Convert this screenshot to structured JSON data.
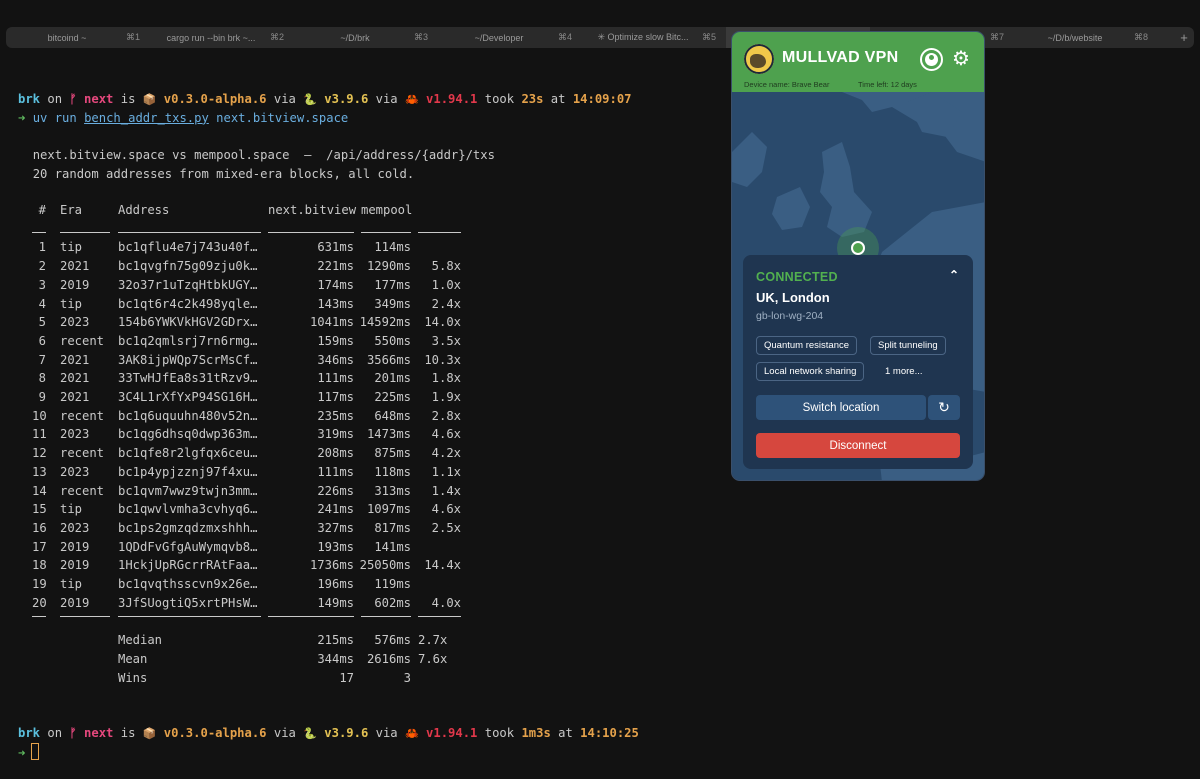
{
  "tabs": [
    {
      "name": "bitcoind ~",
      "key": "⌘1"
    },
    {
      "name": "cargo run --bin brk ~...",
      "key": "⌘2"
    },
    {
      "name": "~/D/brk",
      "key": "⌘3"
    },
    {
      "name": "~/Developer",
      "key": "⌘4"
    },
    {
      "name": "✳ Optimize slow Bitc...",
      "key": "⌘5"
    },
    {
      "name": "",
      "key": ""
    },
    {
      "name": "",
      "key": "⌘7"
    },
    {
      "name": "~/D/b/website",
      "key": "⌘8"
    }
  ],
  "tab_plus": "+",
  "prompt1": {
    "user": "brk",
    "on": " on ",
    "branch_icon": "ᚠ",
    "branch": "next",
    "is": " is ",
    "pkg_icon": "📦",
    "version": "v0.3.0-alpha.6",
    "via1": " via ",
    "py_icon": "🐍",
    "py": "v3.9.6",
    "via2": " via ",
    "rust_icon": "🦀",
    "rust": "v1.94.1",
    "took": " took ",
    "duration": "23s",
    "at": " at ",
    "time": "14:09:07"
  },
  "command": {
    "arrow": "➜",
    "uv": "uv",
    "run": "run",
    "script": "bench_addr_txs.py",
    "arg": "next.bitview.space"
  },
  "desc1": "next.bitview.space vs mempool.space  —  /api/address/{addr}/txs",
  "desc2": "20 random addresses from mixed-era blocks, all cold.",
  "table": {
    "headers": {
      "num": "#",
      "era": "Era",
      "address": "Address",
      "next": "next.bitview",
      "mempool": "mempool"
    },
    "rows": [
      {
        "n": "1",
        "era": "tip",
        "addr": "bc1qflu4e7j743u40f…",
        "next": "631ms",
        "mem": "114ms",
        "ratio": ""
      },
      {
        "n": "2",
        "era": "2021",
        "addr": "bc1qvgfn75g09zju0k…",
        "next": "221ms",
        "mem": "1290ms",
        "ratio": "5.8x"
      },
      {
        "n": "3",
        "era": "2019",
        "addr": "32o37r1uTzqHtbkUGY…",
        "next": "174ms",
        "mem": "177ms",
        "ratio": "1.0x"
      },
      {
        "n": "4",
        "era": "tip",
        "addr": "bc1qt6r4c2k498yqle…",
        "next": "143ms",
        "mem": "349ms",
        "ratio": "2.4x"
      },
      {
        "n": "5",
        "era": "2023",
        "addr": "154b6YWKVkHGV2GDrx…",
        "next": "1041ms",
        "mem": "14592ms",
        "ratio": "14.0x"
      },
      {
        "n": "6",
        "era": "recent",
        "addr": "bc1q2qmlsrj7rn6rmg…",
        "next": "159ms",
        "mem": "550ms",
        "ratio": "3.5x"
      },
      {
        "n": "7",
        "era": "2021",
        "addr": "3AK8ijpWQp7ScrMsCf…",
        "next": "346ms",
        "mem": "3566ms",
        "ratio": "10.3x"
      },
      {
        "n": "8",
        "era": "2021",
        "addr": "33TwHJfEa8s31tRzv9…",
        "next": "111ms",
        "mem": "201ms",
        "ratio": "1.8x"
      },
      {
        "n": "9",
        "era": "2021",
        "addr": "3C4L1rXfYxP94SG16H…",
        "next": "117ms",
        "mem": "225ms",
        "ratio": "1.9x"
      },
      {
        "n": "10",
        "era": "recent",
        "addr": "bc1q6uquuhn480v52n…",
        "next": "235ms",
        "mem": "648ms",
        "ratio": "2.8x"
      },
      {
        "n": "11",
        "era": "2023",
        "addr": "bc1qg6dhsq0dwp363m…",
        "next": "319ms",
        "mem": "1473ms",
        "ratio": "4.6x"
      },
      {
        "n": "12",
        "era": "recent",
        "addr": "bc1qfe8r2lgfqx6ceu…",
        "next": "208ms",
        "mem": "875ms",
        "ratio": "4.2x"
      },
      {
        "n": "13",
        "era": "2023",
        "addr": "bc1p4ypjzznj97f4xu…",
        "next": "111ms",
        "mem": "118ms",
        "ratio": "1.1x"
      },
      {
        "n": "14",
        "era": "recent",
        "addr": "bc1qvm7wwz9twjn3mm…",
        "next": "226ms",
        "mem": "313ms",
        "ratio": "1.4x"
      },
      {
        "n": "15",
        "era": "tip",
        "addr": "bc1qwvlvmha3cvhyq6…",
        "next": "241ms",
        "mem": "1097ms",
        "ratio": "4.6x"
      },
      {
        "n": "16",
        "era": "2023",
        "addr": "bc1ps2gmzqdzmxshhh…",
        "next": "327ms",
        "mem": "817ms",
        "ratio": "2.5x"
      },
      {
        "n": "17",
        "era": "2019",
        "addr": "1QDdFvGfgAuWymqvb8…",
        "next": "193ms",
        "mem": "141ms",
        "ratio": ""
      },
      {
        "n": "18",
        "era": "2019",
        "addr": "1HckjUpRGcrrRAtFaa…",
        "next": "1736ms",
        "mem": "25050ms",
        "ratio": "14.4x"
      },
      {
        "n": "19",
        "era": "tip",
        "addr": "bc1qvqthsscvn9x26e…",
        "next": "196ms",
        "mem": "119ms",
        "ratio": ""
      },
      {
        "n": "20",
        "era": "2019",
        "addr": "3JfSUogtiQ5xrtPHsW…",
        "next": "149ms",
        "mem": "602ms",
        "ratio": "4.0x"
      }
    ],
    "summary": [
      {
        "label": "Median",
        "next": "215ms",
        "mem": "576ms",
        "ratio": "2.7x"
      },
      {
        "label": "Mean",
        "next": "344ms",
        "mem": "2616ms",
        "ratio": "7.6x"
      },
      {
        "label": "Wins",
        "next": "17",
        "mem": "3",
        "ratio": ""
      }
    ]
  },
  "prompt2": {
    "user": "brk",
    "on": " on ",
    "branch_icon": "ᚠ",
    "branch": "next",
    "is": " is ",
    "pkg_icon": "📦",
    "version": "v0.3.0-alpha.6",
    "via1": " via ",
    "py_icon": "🐍",
    "py": "v3.9.6",
    "via2": " via ",
    "rust_icon": "🦀",
    "rust": "v1.94.1",
    "took": " took ",
    "duration": "1m3s",
    "at": " at ",
    "time": "14:10:25"
  },
  "prompt_arrow": "➜",
  "vpn": {
    "title": "MULLVAD VPN",
    "device": "Device name: Brave Bear",
    "time_left": "Time left: 12 days",
    "status": "CONNECTED",
    "location": "UK, London",
    "server": "gb-lon-wg-204",
    "features": [
      "Quantum resistance",
      "Split tunneling",
      "Local network sharing"
    ],
    "more": "1 more...",
    "switch_label": "Switch location",
    "disconnect_label": "Disconnect",
    "accent": "#4ea14e",
    "danger": "#d6473e"
  }
}
